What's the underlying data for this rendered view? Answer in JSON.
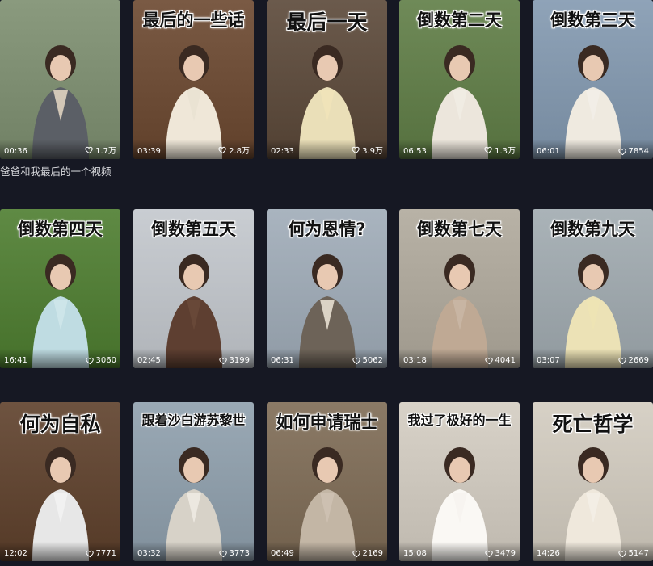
{
  "videos": [
    {
      "duration": "00:36",
      "likes": "1.7万",
      "overlay": "",
      "caption": "爸爸和我最后的一个视频",
      "bg": "#8a9a7e",
      "accent": "#e8d9c5",
      "coat": "#5b5f66"
    },
    {
      "duration": "03:39",
      "likes": "2.8万",
      "overlay": "最后的一些话",
      "bg": "#7a5a44",
      "accent": "#e9e2d2",
      "coat": "#efe7d8"
    },
    {
      "duration": "02:33",
      "likes": "3.9万",
      "overlay": "最后一天",
      "bg": "#6b5a4c",
      "accent": "#f1e4b8",
      "coat": "#eadfb8"
    },
    {
      "duration": "06:53",
      "likes": "1.3万",
      "overlay": "倒数第二天",
      "bg": "#6f8a58",
      "accent": "#f1ece4",
      "coat": "#ece6dc"
    },
    {
      "duration": "06:01",
      "likes": "7854",
      "overlay": "倒数第三天",
      "bg": "#8fa3b8",
      "accent": "#f2efe8",
      "coat": "#efeae0"
    },
    {
      "duration": "16:41",
      "likes": "3060",
      "overlay": "倒数第四天",
      "bg": "#5f8a44",
      "accent": "#cfe6ea",
      "coat": "#bfdce2"
    },
    {
      "duration": "02:45",
      "likes": "3199",
      "overlay": "倒数第五天",
      "bg": "#c9cdd2",
      "accent": "#6a4a3a",
      "coat": "#5e3f31"
    },
    {
      "duration": "06:31",
      "likes": "5062",
      "overlay": "何为恩情?",
      "bg": "#a9b4bf",
      "accent": "#efe6d8",
      "coat": "#6d6358"
    },
    {
      "duration": "03:18",
      "likes": "4041",
      "overlay": "倒数第七天",
      "bg": "#b8b2a6",
      "accent": "#c9b7a6",
      "coat": "#bfa994"
    },
    {
      "duration": "03:07",
      "likes": "2669",
      "overlay": "倒数第九天",
      "bg": "#aab3b8",
      "accent": "#efe4b4",
      "coat": "#ece2b6"
    },
    {
      "duration": "12:02",
      "likes": "7771",
      "overlay": "何为自私",
      "bg": "#6e5340",
      "accent": "#f2f2f2",
      "coat": "#e7e7e7"
    },
    {
      "duration": "03:32",
      "likes": "3773",
      "overlay": "跟着沙白游苏黎世",
      "bg": "#9aa9b5",
      "accent": "#f0ece4",
      "coat": "#d7d2c8"
    },
    {
      "duration": "06:49",
      "likes": "2169",
      "overlay": "如何申请瑞士",
      "bg": "#8b7a66",
      "accent": "#cfc2b3",
      "coat": "#c3b6a5"
    },
    {
      "duration": "15:08",
      "likes": "3479",
      "overlay": "我过了极好的一生",
      "bg": "#d8d2c8",
      "accent": "#f6f3ee",
      "coat": "#faf8f4"
    },
    {
      "duration": "14:26",
      "likes": "5147",
      "overlay": "死亡哲学",
      "bg": "#d7d1c6",
      "accent": "#f3efe6",
      "coat": "#efe8dc"
    }
  ],
  "colors": {
    "page_bg": "#161823",
    "caption": "#d7d8dc",
    "overlay_text": "#111111"
  },
  "icons": {
    "likes": "heart-outline-icon"
  }
}
